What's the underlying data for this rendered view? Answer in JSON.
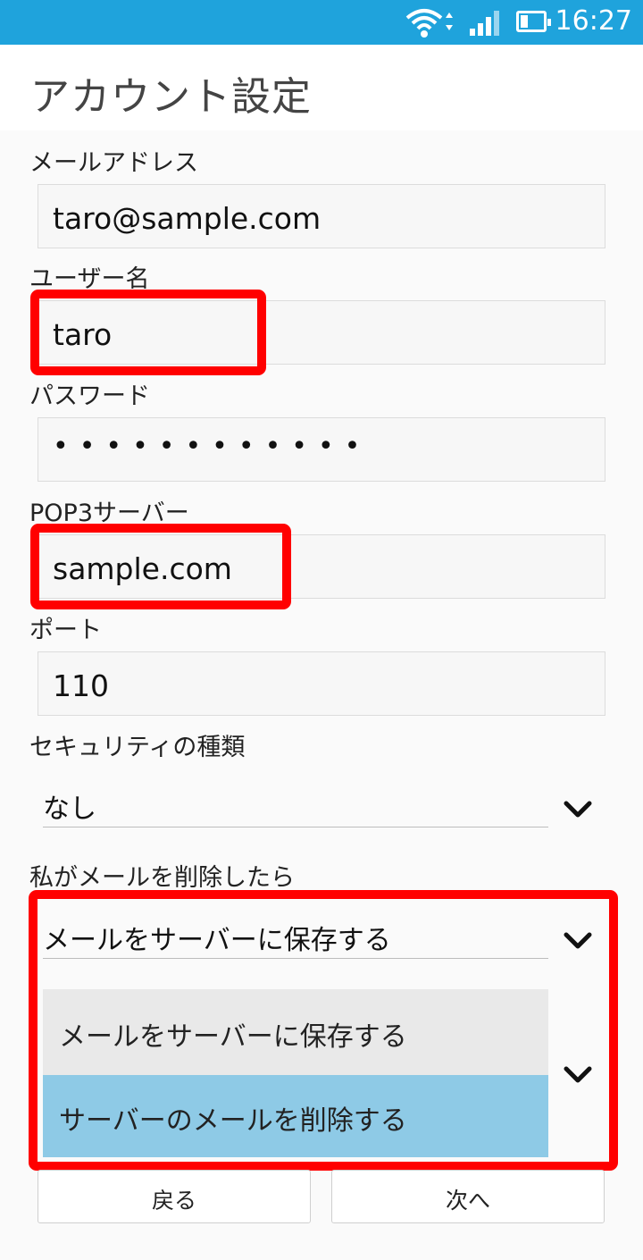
{
  "status": {
    "time": "16:27",
    "battery_level": 0.35,
    "signal_level": 4
  },
  "title": "アカウント設定",
  "fields": {
    "email": {
      "label": "メールアドレス",
      "value": "taro@sample.com"
    },
    "username": {
      "label": "ユーザー名",
      "value": "taro"
    },
    "password": {
      "label": "パスワード",
      "value": "••••••••••••"
    },
    "server": {
      "label": "POP3サーバー",
      "value": "sample.com"
    },
    "port": {
      "label": "ポート",
      "value": "110"
    }
  },
  "security": {
    "label": "セキュリティの種類",
    "value": "なし"
  },
  "delete_policy": {
    "label": "私がメールを削除したら",
    "value": "メールをサーバーに保存する",
    "options": [
      "メールをサーバーに保存する",
      "サーバーのメールを削除する"
    ],
    "highlighted_index": 1
  },
  "buttons": {
    "back": "戻る",
    "next": "次へ"
  },
  "colors": {
    "status_bar": "#1fa3dc",
    "annotation_red": "#ff0000",
    "highlight": "#8ecae6"
  }
}
